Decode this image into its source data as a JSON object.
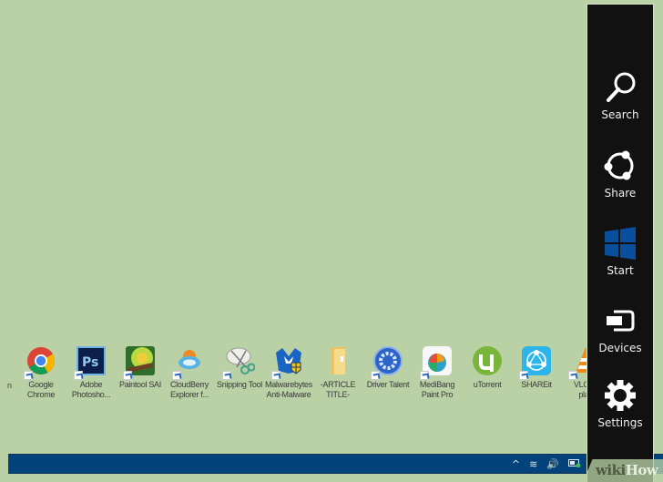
{
  "desktop": {
    "background_color": "#b9d1a5",
    "partial_icon_label": "n",
    "icons": [
      {
        "name": "google-chrome",
        "label": "Google\nChrome",
        "icon": "chrome-icon"
      },
      {
        "name": "adobe-photoshop",
        "label": "Adobe\nPhotosho...",
        "icon": "photoshop-icon"
      },
      {
        "name": "paintool-sai",
        "label": "Paintool SAI",
        "icon": "paintool-sai-icon"
      },
      {
        "name": "cloudberry-explorer",
        "label": "CloudBerry\nExplorer f...",
        "icon": "cloudberry-icon"
      },
      {
        "name": "snipping-tool",
        "label": "Snipping Tool",
        "icon": "snipping-tool-icon"
      },
      {
        "name": "malwarebytes",
        "label": "Malwarebytes\nAnti-Malware",
        "icon": "malwarebytes-icon"
      },
      {
        "name": "article-title-folder",
        "label": "-ARTICLE\nTITLE-",
        "icon": "folder-icon"
      },
      {
        "name": "driver-talent",
        "label": "Driver Talent",
        "icon": "driver-talent-icon"
      },
      {
        "name": "medibang-paint-pro",
        "label": "MediBang\nPaint Pro",
        "icon": "medibang-icon"
      },
      {
        "name": "utorrent",
        "label": "uTorrent",
        "icon": "utorrent-icon"
      },
      {
        "name": "shareit",
        "label": "SHAREit",
        "icon": "shareit-icon"
      },
      {
        "name": "vlc-media-player",
        "label": "VLC m\nplay",
        "icon": "vlc-icon"
      }
    ]
  },
  "taskbar": {
    "color": "#03427a",
    "tray": [
      {
        "name": "show-hidden-icons",
        "glyph": "^"
      },
      {
        "name": "wifi-icon",
        "glyph": "≋"
      },
      {
        "name": "volume-icon",
        "glyph": "🔊"
      },
      {
        "name": "battery-icon",
        "glyph": "▭"
      }
    ]
  },
  "charms_bar": {
    "background": "#111111",
    "items": [
      {
        "name": "search",
        "label": "Search"
      },
      {
        "name": "share",
        "label": "Share"
      },
      {
        "name": "start",
        "label": "Start"
      },
      {
        "name": "devices",
        "label": "Devices"
      },
      {
        "name": "settings",
        "label": "Settings"
      }
    ],
    "start_color": "#0a4f9c"
  },
  "watermark": {
    "wiki": "wiki",
    "how": "How"
  }
}
